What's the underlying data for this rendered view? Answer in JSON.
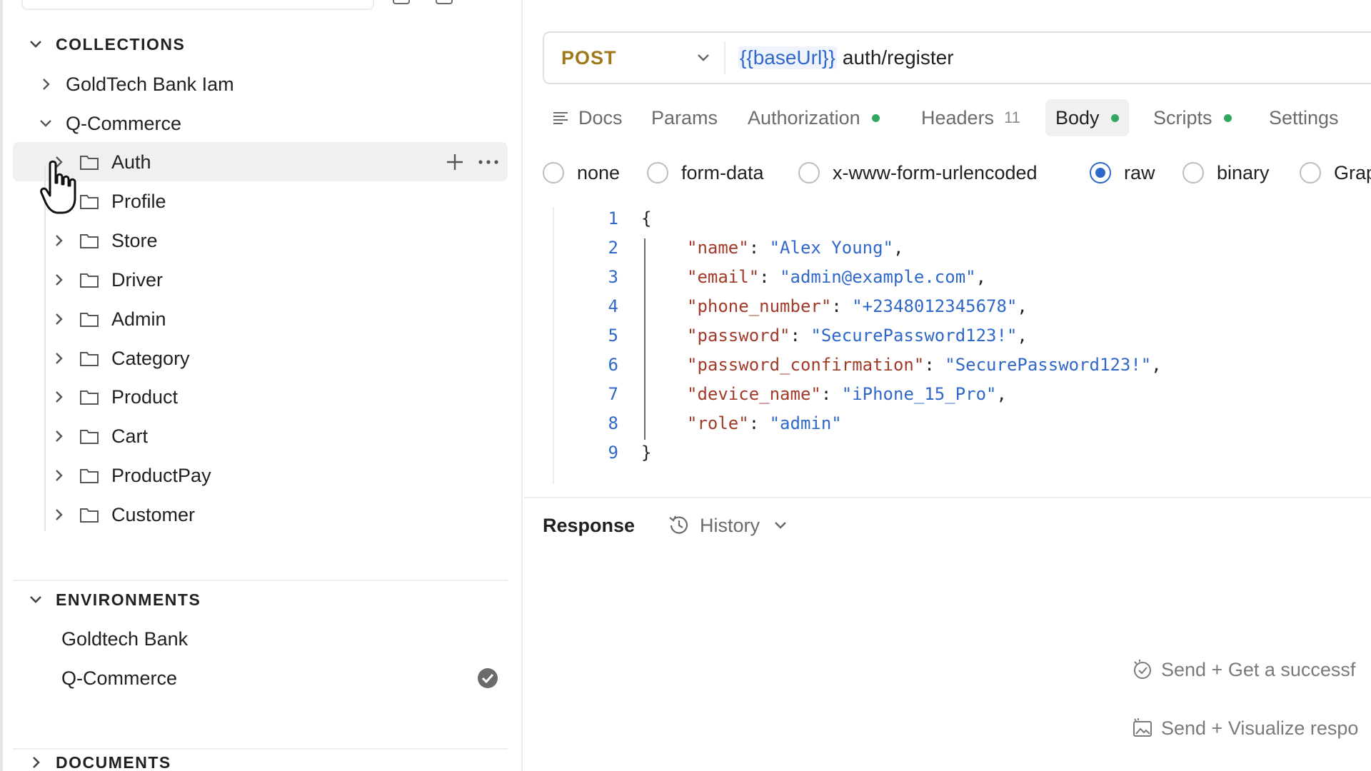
{
  "sidebar": {
    "collections_header": "COLLECTIONS",
    "collections": [
      {
        "label": "GoldTech Bank Iam",
        "expanded": false
      },
      {
        "label": "Q-Commerce",
        "expanded": true
      }
    ],
    "folders": [
      "Auth",
      "Profile",
      "Store",
      "Driver",
      "Admin",
      "Category",
      "Product",
      "Cart",
      "ProductPay",
      "Customer"
    ],
    "environments_header": "ENVIRONMENTS",
    "environments": [
      {
        "label": "Goldtech Bank",
        "active": false
      },
      {
        "label": "Q-Commerce",
        "active": true
      }
    ],
    "documents_header": "DOCUMENTS"
  },
  "request": {
    "method": "POST",
    "url_variable": "{{baseUrl}}",
    "url_path": "auth/register"
  },
  "tabs": {
    "docs": "Docs",
    "params": "Params",
    "authorization": "Authorization",
    "headers": "Headers",
    "headers_count": "11",
    "body": "Body",
    "scripts": "Scripts",
    "settings": "Settings"
  },
  "body_types": [
    "none",
    "form-data",
    "x-www-form-urlencoded",
    "raw",
    "binary",
    "Grap"
  ],
  "selected_body_type": "raw",
  "editor": {
    "line_numbers": [
      "1",
      "2",
      "3",
      "4",
      "5",
      "6",
      "7",
      "8",
      "9"
    ],
    "open_brace": "{",
    "close_brace": "}",
    "fields": [
      {
        "key": "\"name\"",
        "value": "\"Alex Young\"",
        "comma": ","
      },
      {
        "key": "\"email\"",
        "value": "\"admin@example.com\"",
        "comma": ","
      },
      {
        "key": "\"phone_number\"",
        "value": "\"+2348012345678\"",
        "comma": ","
      },
      {
        "key": "\"password\"",
        "value": "\"SecurePassword123!\"",
        "comma": ","
      },
      {
        "key": "\"password_confirmation\"",
        "value": "\"SecurePassword123!\"",
        "comma": ","
      },
      {
        "key": "\"device_name\"",
        "value": "\"iPhone_15_Pro\"",
        "comma": ","
      },
      {
        "key": "\"role\"",
        "value": "\"admin\"",
        "comma": ""
      }
    ]
  },
  "response": {
    "title": "Response",
    "history_label": "History",
    "hints": [
      "Send + Get a successf",
      "Send + Visualize respo"
    ]
  },
  "colors": {
    "accent": "#2f68c9",
    "method": "#a0781a",
    "status_dot": "#2fa861"
  }
}
